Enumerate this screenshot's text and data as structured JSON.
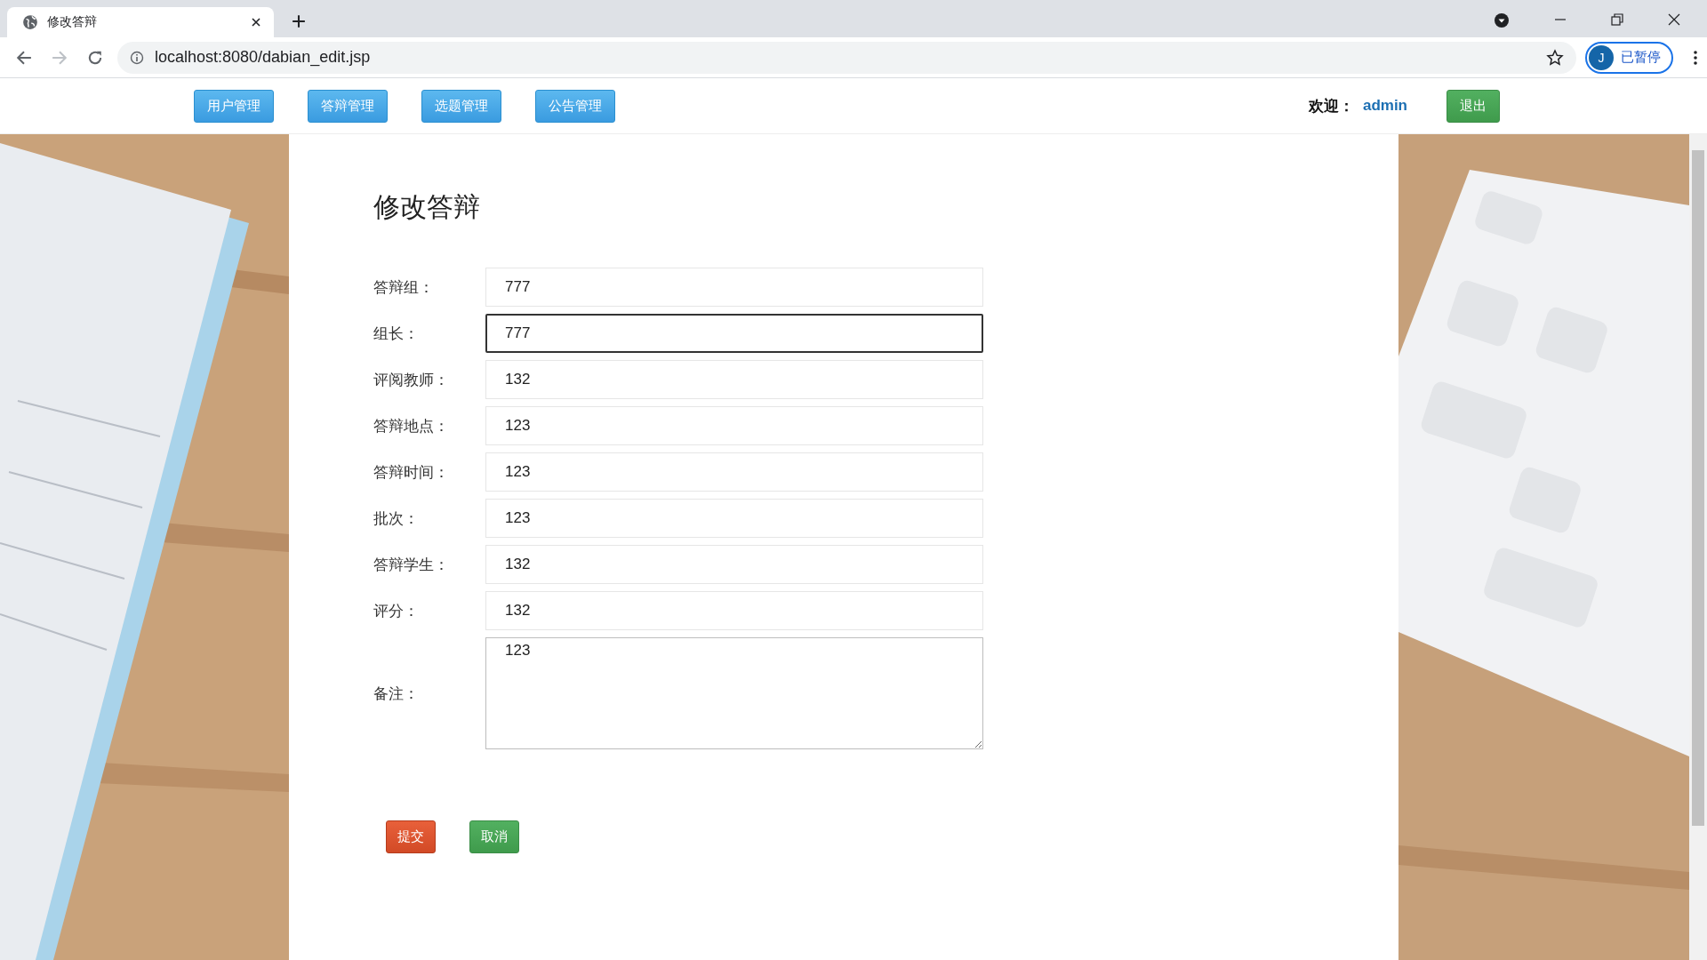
{
  "browser": {
    "tab_title": "修改答辩",
    "url": "localhost:8080/dabian_edit.jsp",
    "profile_initial": "J",
    "profile_status": "已暂停"
  },
  "nav": {
    "items": [
      {
        "label": "用户管理"
      },
      {
        "label": "答辩管理"
      },
      {
        "label": "选题管理"
      },
      {
        "label": "公告管理"
      }
    ],
    "welcome_label": "欢迎：",
    "user": "admin",
    "logout": "退出"
  },
  "form": {
    "title": "修改答辩",
    "fields": [
      {
        "kind": "input",
        "label": "答辩组：",
        "value": "777",
        "focused": false
      },
      {
        "kind": "input",
        "label": "组长：",
        "value": "777",
        "focused": true
      },
      {
        "kind": "input",
        "label": "评阅教师：",
        "value": "132",
        "focused": false
      },
      {
        "kind": "input",
        "label": "答辩地点：",
        "value": "123",
        "focused": false
      },
      {
        "kind": "input",
        "label": "答辩时间：",
        "value": "123",
        "focused": false
      },
      {
        "kind": "input",
        "label": "批次：",
        "value": "123",
        "focused": false
      },
      {
        "kind": "input",
        "label": "答辩学生：",
        "value": "132",
        "focused": false
      },
      {
        "kind": "input",
        "label": "评分：",
        "value": "132",
        "focused": false
      },
      {
        "kind": "textarea",
        "label": "备注：",
        "value": "123",
        "focused": false
      }
    ],
    "buttons": [
      {
        "kind": "submit",
        "label": "提交"
      },
      {
        "kind": "cancel",
        "label": "取消"
      }
    ]
  }
}
